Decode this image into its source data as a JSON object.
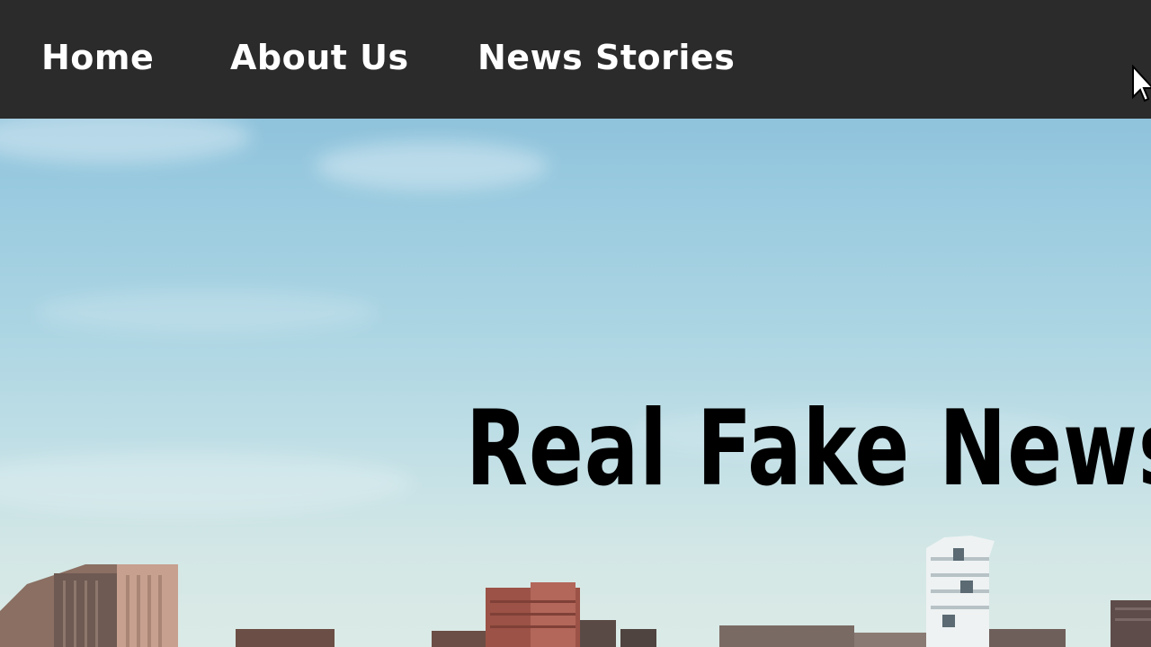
{
  "nav": {
    "home": "Home",
    "about": "About Us",
    "news": "News Stories"
  },
  "hero": {
    "title": "Real Fake News"
  },
  "colors": {
    "navbar": "#2b2b2b",
    "nav_text": "#ffffff",
    "title_text": "#000000",
    "sky_top": "#8fc3dc",
    "sky_bottom": "#dbeae6"
  },
  "icons": {
    "cursor": "mouse-pointer-icon"
  }
}
